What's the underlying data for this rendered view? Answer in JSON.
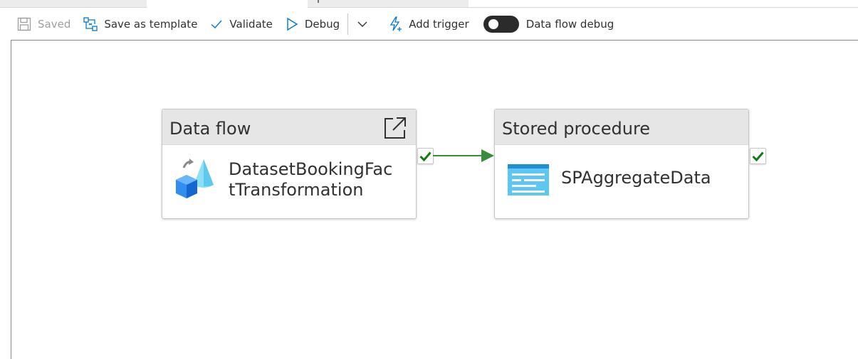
{
  "toolbar": {
    "saved_label": "Saved",
    "save_template_label": "Save as template",
    "validate_label": "Validate",
    "debug_label": "Debug",
    "add_trigger_label": "Add trigger",
    "data_flow_debug_label": "Data flow debug",
    "data_flow_debug_on": false
  },
  "activities": [
    {
      "type_label": "Data flow",
      "name_line1": "DatasetBookingFac",
      "name_line2": "tTransformation",
      "icon": "data-flow-icon",
      "status": "success"
    },
    {
      "type_label": "Stored procedure",
      "name": "SPAggregateData",
      "icon": "stored-procedure-icon",
      "status": "success"
    }
  ],
  "connection": {
    "from": "Data flow",
    "to": "Stored procedure",
    "condition": "success"
  },
  "colors": {
    "success": "#107c10",
    "accent": "#0078d4",
    "connector": "#3c8a3c"
  }
}
